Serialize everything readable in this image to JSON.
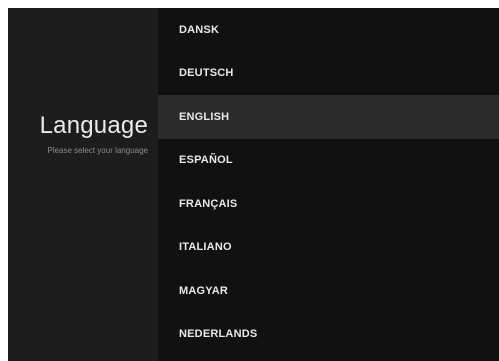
{
  "header": {
    "title": "Language",
    "subtitle": "Please select your language"
  },
  "languages": [
    {
      "label": "DANSK"
    },
    {
      "label": "DEUTSCH"
    },
    {
      "label": "ENGLISH",
      "selected": true
    },
    {
      "label": "ESPAÑOL"
    },
    {
      "label": "FRANÇAIS"
    },
    {
      "label": "ITALIANO"
    },
    {
      "label": "MAGYAR"
    },
    {
      "label": "NEDERLANDS"
    }
  ],
  "colors": {
    "left_panel": "#1d1d1d",
    "list_background": "#111111",
    "selected_row": "#2b2b2b",
    "text": "#e8e8e8",
    "subtitle": "#8c8c8c"
  }
}
